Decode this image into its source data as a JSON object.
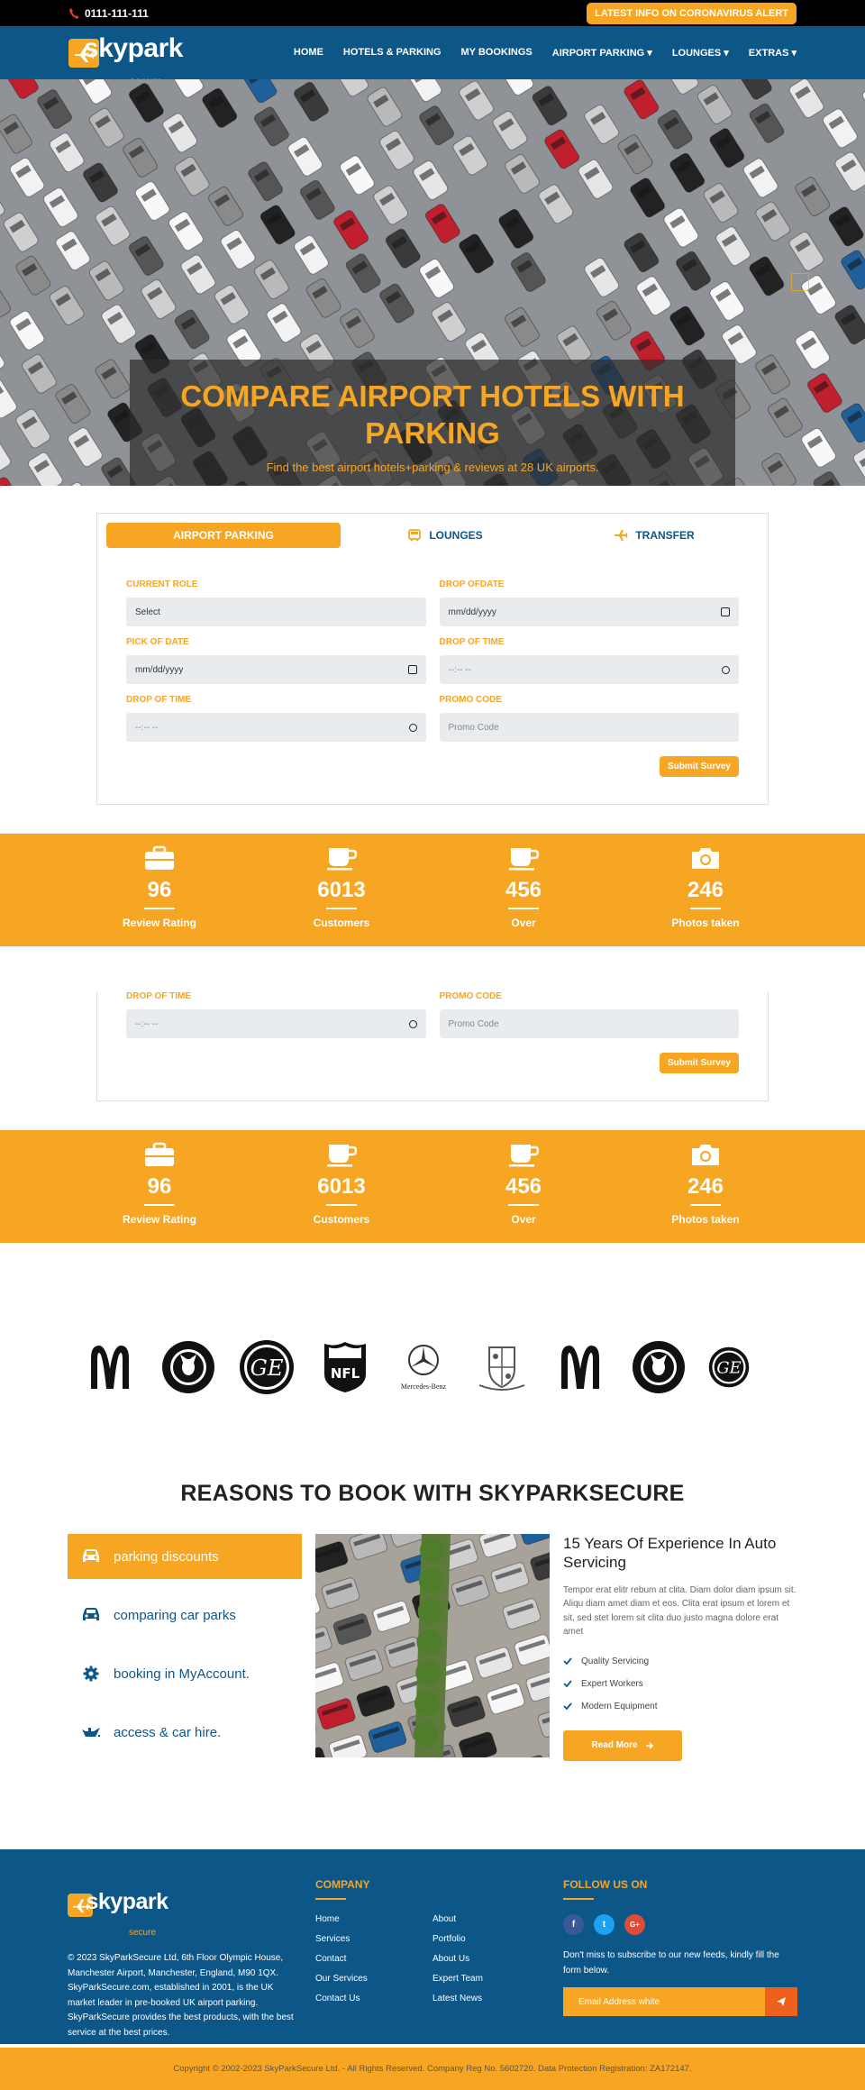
{
  "topbar": {
    "phone": "0111-111-111",
    "alert": "LATEST INFO ON CORONAVIRUS ALERT"
  },
  "brand": {
    "name": "skypark",
    "sub": "secure"
  },
  "nav": [
    {
      "label": "HOME"
    },
    {
      "label": "HOTELS & PARKING"
    },
    {
      "label": "MY BOOKINGS"
    },
    {
      "label": "AIRPORT PARKING ▾"
    },
    {
      "label": "LOUNGES ▾"
    },
    {
      "label": "EXTRAS ▾"
    }
  ],
  "hero": {
    "title": "COMPARE AIRPORT HOTELS WITH PARKING",
    "subtitle": "Find the best airport hotels+parking & reviews at 28 UK airports."
  },
  "booking": {
    "tabs": [
      {
        "label": "AIRPORT PARKING"
      },
      {
        "label": "LOUNGES"
      },
      {
        "label": "TRANSFER"
      }
    ],
    "fields": [
      {
        "label": "CURRENT ROLE",
        "value": "Select",
        "kind": "select"
      },
      {
        "label": "DROP OFDATE",
        "value": "mm/dd/yyyy",
        "kind": "date"
      },
      {
        "label": "PICK OF DATE",
        "value": "mm/dd/yyyy",
        "kind": "date"
      },
      {
        "label": "DROP OF TIME",
        "value": "--:-- --",
        "kind": "time"
      },
      {
        "label": "DROP OF TIME",
        "value": "--:-- --",
        "kind": "time"
      },
      {
        "label": "PROMO CODE",
        "placeholder": "Promo Code",
        "kind": "text"
      }
    ],
    "submit": "Submit Survey"
  },
  "stats": [
    {
      "icon": "briefcase-icon",
      "value": "96",
      "label": "Review Rating"
    },
    {
      "icon": "coffee-cup-icon",
      "value": "6013",
      "label": "Customers"
    },
    {
      "icon": "coffee-cup-icon",
      "value": "456",
      "label": "Over"
    },
    {
      "icon": "camera-icon",
      "value": "246",
      "label": "Photos taken"
    }
  ],
  "brands": [
    {
      "name": "mcdonalds-logo"
    },
    {
      "name": "starbucks-logo"
    },
    {
      "name": "ge-logo"
    },
    {
      "name": "nfl-logo"
    },
    {
      "name": "mercedes-benz-logo",
      "text": "Mercedes-Benz"
    },
    {
      "name": "hogwarts-crest"
    },
    {
      "name": "mcdonalds-logo"
    },
    {
      "name": "starbucks-logo"
    },
    {
      "name": "ge-logo"
    }
  ],
  "reasons": {
    "title": "REASONS TO BOOK WITH SKYPARKSECURE",
    "items": [
      {
        "icon": "car-icon",
        "label": "parking discounts"
      },
      {
        "icon": "car-icon",
        "label": "comparing car parks"
      },
      {
        "icon": "gear-icon",
        "label": "booking in MyAccount."
      },
      {
        "icon": "oil-can-icon",
        "label": "access & car hire."
      }
    ],
    "heading": "15 Years Of Experience In Auto Servicing",
    "body": "Tempor erat elitr rebum at clita. Diam dolor diam ipsum sit. Aliqu diam amet diam et eos. Clita erat ipsum et lorem et sit, sed stet lorem sit clita duo justo magna dolore erat amet",
    "checks": [
      "Quality Servicing",
      "Expert Workers",
      "Modern Equipment"
    ],
    "button": "Read More"
  },
  "footer": {
    "about": "© 2023 SkyParkSecure Ltd, 6th Floor Olympic House, Manchester Airport, Manchester, England, M90 1QX. SkyParkSecure.com, established in 2001, is the UK market leader in pre-booked UK airport parking. SkyParkSecure provides the best products, with the best service at the best prices.",
    "company_title": "COMPANY",
    "links": [
      "Home",
      "About",
      "Services",
      "Portfolio",
      "Contact",
      "About Us",
      "Our Services",
      "Expert Team",
      "Contact Us",
      "Latest News"
    ],
    "follow_title": "FOLLOW US ON",
    "social": [
      {
        "label": "f"
      },
      {
        "label": "t"
      },
      {
        "label": "G+"
      }
    ],
    "newsletter_text": "Don't miss to subscribe to our new feeds, kindly fill the form below.",
    "email_placeholder": "Email Address white",
    "copyright": "Copyright © 2002-2023 SkyParkSecure Ltd. - All Rights Reserved. Company Reg No. 5602720. Data Protection Registration: ZA172147."
  },
  "colors": {
    "accent": "#f6a623",
    "navy": "#0d5688",
    "dark": "#000000"
  }
}
